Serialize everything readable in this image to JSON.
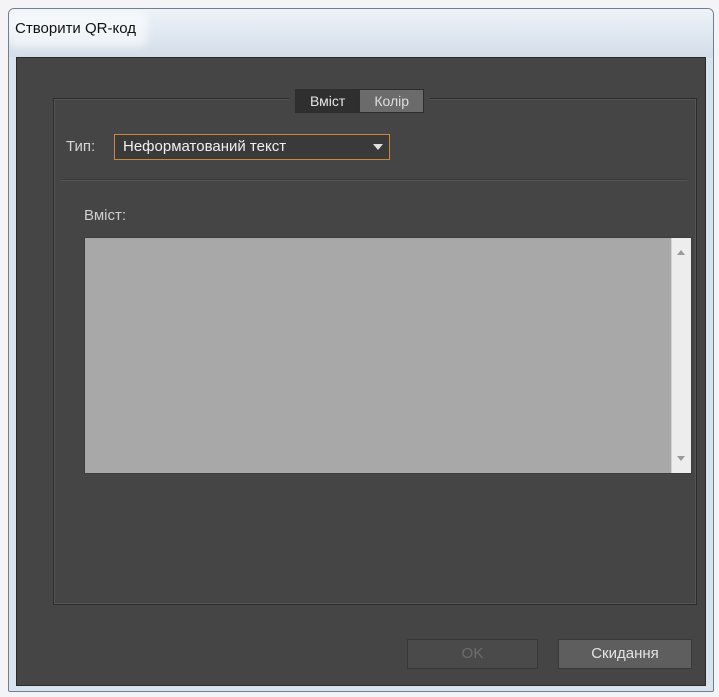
{
  "window": {
    "title": "Створити QR-код"
  },
  "tabs": [
    {
      "label": "Вміст",
      "active": true
    },
    {
      "label": "Колір",
      "active": false
    }
  ],
  "type_field": {
    "label": "Тип:",
    "selected": "Неформатований текст",
    "icon": "chevron-down-icon"
  },
  "content_field": {
    "label": "Вміст:",
    "value": ""
  },
  "buttons": {
    "ok_label": "OK",
    "ok_enabled": false,
    "cancel_label": "Скидання"
  },
  "colors": {
    "dialog_background": "#454545",
    "focus_border": "#c98a3e",
    "text_area": "#a8a8a8"
  }
}
